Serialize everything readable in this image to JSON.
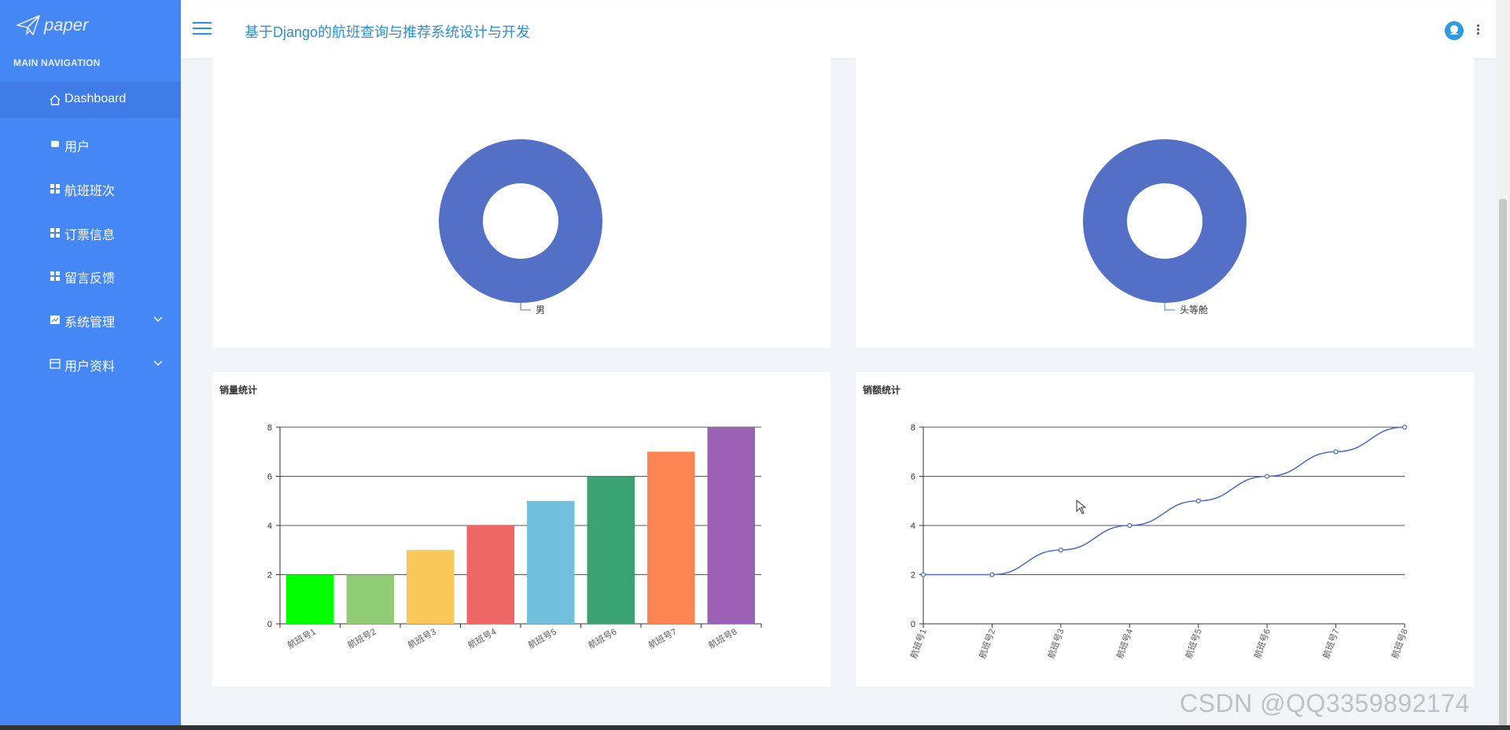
{
  "sidebar": {
    "brand": "paper",
    "heading": "MAIN NAVIGATION",
    "items": [
      {
        "label": "Dashboard",
        "icon": "home-icon"
      },
      {
        "label": "用户",
        "icon": "user-icon"
      },
      {
        "label": "航班班次",
        "icon": "grid-icon"
      },
      {
        "label": "订票信息",
        "icon": "grid-icon"
      },
      {
        "label": "留言反馈",
        "icon": "grid-icon"
      },
      {
        "label": "系统管理",
        "icon": "chart-icon"
      },
      {
        "label": "用户资料",
        "icon": "card-icon"
      }
    ]
  },
  "header": {
    "title": "基于Django的航班查询与推荐系统设计与开发"
  },
  "watermark": "CSDN @QQ3359892174",
  "colors": {
    "sidebar": "#4587f5",
    "accent": "#2c8fd6",
    "pie": "#5470c6",
    "line": "#5470c6"
  },
  "chart_data": [
    {
      "type": "pie",
      "slices": [
        {
          "label": "男",
          "value": 1
        }
      ]
    },
    {
      "type": "pie",
      "slices": [
        {
          "label": "头等舱",
          "value": 1
        }
      ]
    },
    {
      "type": "bar",
      "title": "销量统计",
      "categories": [
        "航班号1",
        "航班号2",
        "航班号3",
        "航班号4",
        "航班号5",
        "航班号6",
        "航班号7",
        "航班号8"
      ],
      "values": [
        2,
        2,
        3,
        4,
        5,
        6,
        7,
        8
      ],
      "colors": [
        "#00ff00",
        "#91cc75",
        "#fac858",
        "#ee6666",
        "#73c0de",
        "#3ba272",
        "#fc8452",
        "#9a60b4"
      ],
      "ylim": [
        0,
        8
      ],
      "yticks": [
        "0",
        "2",
        "4",
        "6",
        "8"
      ],
      "grid": true
    },
    {
      "type": "line",
      "title": "销额统计",
      "categories": [
        "航班号1",
        "航班号2",
        "航班号3",
        "航班号4",
        "航班号5",
        "航班号6",
        "航班号7",
        "航班号8"
      ],
      "values": [
        2,
        2,
        3,
        4,
        5,
        6,
        7,
        8
      ],
      "ylim": [
        0,
        8
      ],
      "yticks": [
        "0",
        "2",
        "4",
        "6",
        "8"
      ],
      "grid": true
    }
  ]
}
